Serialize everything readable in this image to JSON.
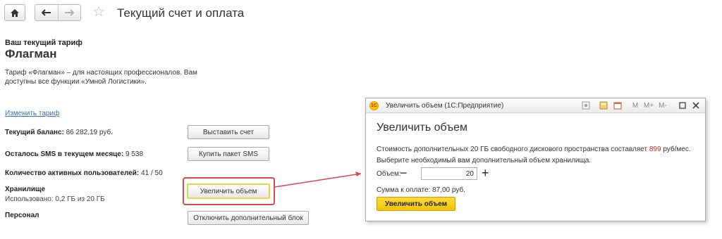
{
  "header": {
    "title": "Текущий счет и оплата"
  },
  "tariff": {
    "label": "Ваш текущий тариф",
    "name": "Флагман",
    "description": "Тариф «Флагман» – для настоящих профессионалов. Вам доступны все функции «Умной Логистики».",
    "change_link": "Изменить тариф"
  },
  "rows": {
    "balance_label": "Текущий баланс:",
    "balance_value": "86 282,19 руб.",
    "sms_label": "Осталось SMS в текущем месяце:",
    "sms_value": "9 538",
    "users_label": "Количество активных пользователей:",
    "users_value": "41 / 50",
    "storage_label": "Хранилище",
    "storage_used": "Использовано: 0,2 ГБ из 20 ГБ",
    "personnel_label": "Персонал"
  },
  "buttons": {
    "invoice": "Выставить счет",
    "buy_sms": "Купить пакет SMS",
    "increase_volume": "Увеличить объем",
    "disable_block": "Отключить дополнительный блок"
  },
  "dialog": {
    "window_title": "Увеличить объем  (1С:Предприятие)",
    "logo_text": "1C",
    "toolbar_icons": [
      "info-icon",
      "calculator-icon",
      "calendar-icon",
      "m-icon",
      "m-plus-icon",
      "m-minus-icon",
      "maximize-icon",
      "close-icon"
    ],
    "toolbar_labels": {
      "m": "M",
      "m_plus": "M+",
      "m_minus": "M-"
    },
    "heading": "Увеличить объем",
    "cost_text_prefix": "Стоимость дополнительных 20 ГБ свободного дискового пространства составляет",
    "cost_value": "899",
    "cost_text_suffix": "руб/мес.",
    "instruction": "Выберите необходимый вам дополнительный объем хранилища.",
    "volume_label": "Объем:",
    "volume_value": "20",
    "sum_text": "Сумма к оплате: 87,00 руб.",
    "confirm_button": "Увеличить объем"
  },
  "colors": {
    "highlight": "#e04848",
    "primary_button": "#f3c400",
    "link": "#3c6eb4",
    "price": "#e02020"
  }
}
